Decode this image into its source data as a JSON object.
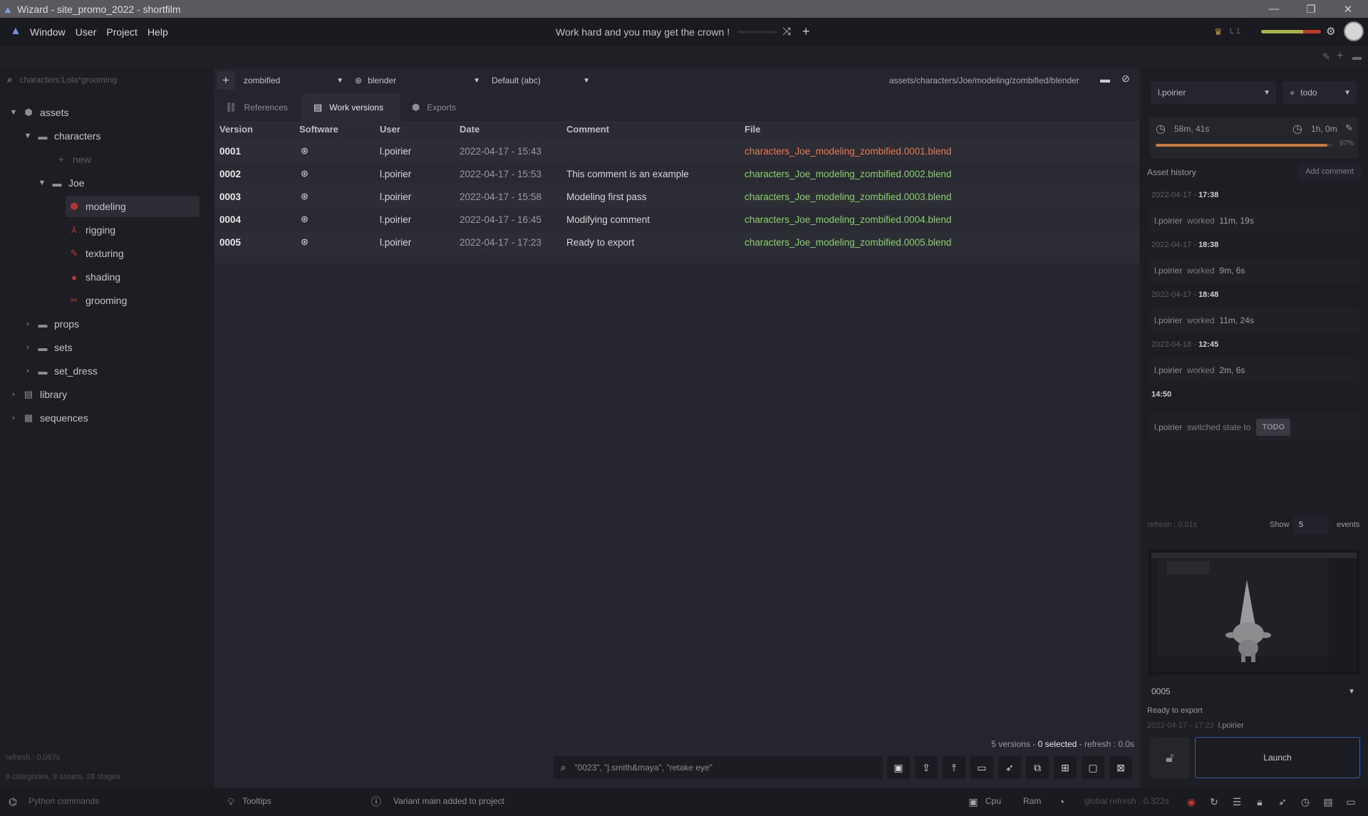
{
  "window": {
    "title": "Wizard - site_promo_2022 - shortfilm"
  },
  "menu": [
    "Window",
    "User",
    "Project",
    "Help"
  ],
  "motto": "Work hard and you may get the crown !",
  "user_level": "L 1",
  "left": {
    "search_placeholder": "characters:Lola*grooming",
    "tree": [
      {
        "label": "assets",
        "icon": "cube-icon"
      },
      {
        "label": "characters",
        "icon": "folder-icon"
      },
      {
        "label": "new",
        "icon": "plus-icon"
      },
      {
        "label": "Joe",
        "icon": "folder-icon"
      },
      {
        "label": "modeling",
        "icon": "cube-red-icon"
      },
      {
        "label": "rigging",
        "icon": "rig-icon"
      },
      {
        "label": "texturing",
        "icon": "brush-icon"
      },
      {
        "label": "shading",
        "icon": "sphere-icon"
      },
      {
        "label": "grooming",
        "icon": "scissors-icon"
      },
      {
        "label": "props",
        "icon": "folder-icon"
      },
      {
        "label": "sets",
        "icon": "folder-icon"
      },
      {
        "label": "set_dress",
        "icon": "folder-icon"
      },
      {
        "label": "library",
        "icon": "library-icon"
      },
      {
        "label": "sequences",
        "icon": "sequences-icon"
      }
    ],
    "refresh": "refresh : 0.097s",
    "summary": "8 categories, 9 assets, 28 stages"
  },
  "toolbar": {
    "variant": "zombified",
    "software": "blender",
    "export_format": "Default (abc)",
    "path": "assets/characters/Joe/modeling/zombified/blender"
  },
  "tabs": [
    {
      "label": "References"
    },
    {
      "label": "Work versions"
    },
    {
      "label": "Exports"
    }
  ],
  "table": {
    "headers": [
      "Version",
      "Software",
      "User",
      "Date",
      "Comment",
      "File"
    ],
    "rows": [
      {
        "version": "0001",
        "user": "l.poirier",
        "date": "2022-04-17 - 15:43",
        "comment": "",
        "file": "characters_Joe_modeling_zombified.0001.blend",
        "missing": true
      },
      {
        "version": "0002",
        "user": "l.poirier",
        "date": "2022-04-17 - 15:53",
        "comment": "This comment is an example",
        "file": "characters_Joe_modeling_zombified.0002.blend",
        "missing": false
      },
      {
        "version": "0003",
        "user": "l.poirier",
        "date": "2022-04-17 - 15:58",
        "comment": "Modeling first pass",
        "file": "characters_Joe_modeling_zombified.0003.blend",
        "missing": false
      },
      {
        "version": "0004",
        "user": "l.poirier",
        "date": "2022-04-17 - 16:45",
        "comment": "Modifying comment",
        "file": "characters_Joe_modeling_zombified.0004.blend",
        "missing": false
      },
      {
        "version": "0005",
        "user": "l.poirier",
        "date": "2022-04-17 - 17:23",
        "comment": "Ready to export",
        "file": "characters_Joe_modeling_zombified.0005.blend",
        "missing": false
      }
    ]
  },
  "status": {
    "versions": "5 versions",
    "selected": "0 selected",
    "refresh": "refresh : 0.0s"
  },
  "search": {
    "placeholder": "\"0023\", \"j.smith&maya\", \"retake eye\""
  },
  "right": {
    "user": "l.poirier",
    "state": "todo",
    "time_spent": "58m, 41s",
    "estimated": "1h, 0m",
    "progress": "97%",
    "history_label": "Asset history",
    "add_comment": "Add comment",
    "events": [
      {
        "date": "2022-04-17",
        "time": "17:38",
        "user": "l.poirier",
        "action": "worked",
        "value": "11m, 19s"
      },
      {
        "date": "2022-04-17",
        "time": "18:38",
        "user": "l.poirier",
        "action": "worked",
        "value": "9m, 6s"
      },
      {
        "date": "2022-04-17",
        "time": "18:48",
        "user": "l.poirier",
        "action": "worked",
        "value": "11m, 24s"
      },
      {
        "date": "2022-04-18",
        "time": "12:45",
        "user": "l.poirier",
        "action": "worked",
        "value": "2m, 6s"
      },
      {
        "date": "",
        "time": "14:50",
        "user": "l.poirier",
        "action": "switched state to",
        "value": "TODO"
      }
    ],
    "refresh": "refresh : 0.01s",
    "show_label": "Show",
    "show_count": "5",
    "events_label": "events",
    "version_select": "0005",
    "version_comment": "Ready to export",
    "version_date": "2022-04-17 - 17:23",
    "version_user": "l.poirier",
    "launch": "Launch"
  },
  "statusbar": {
    "python": "Python commands",
    "tooltips": "Tooltips",
    "message": "Variant main added to project",
    "cpu": "Cpu",
    "ram": "Ram",
    "global_refresh": "global refresh : 0.322s"
  }
}
